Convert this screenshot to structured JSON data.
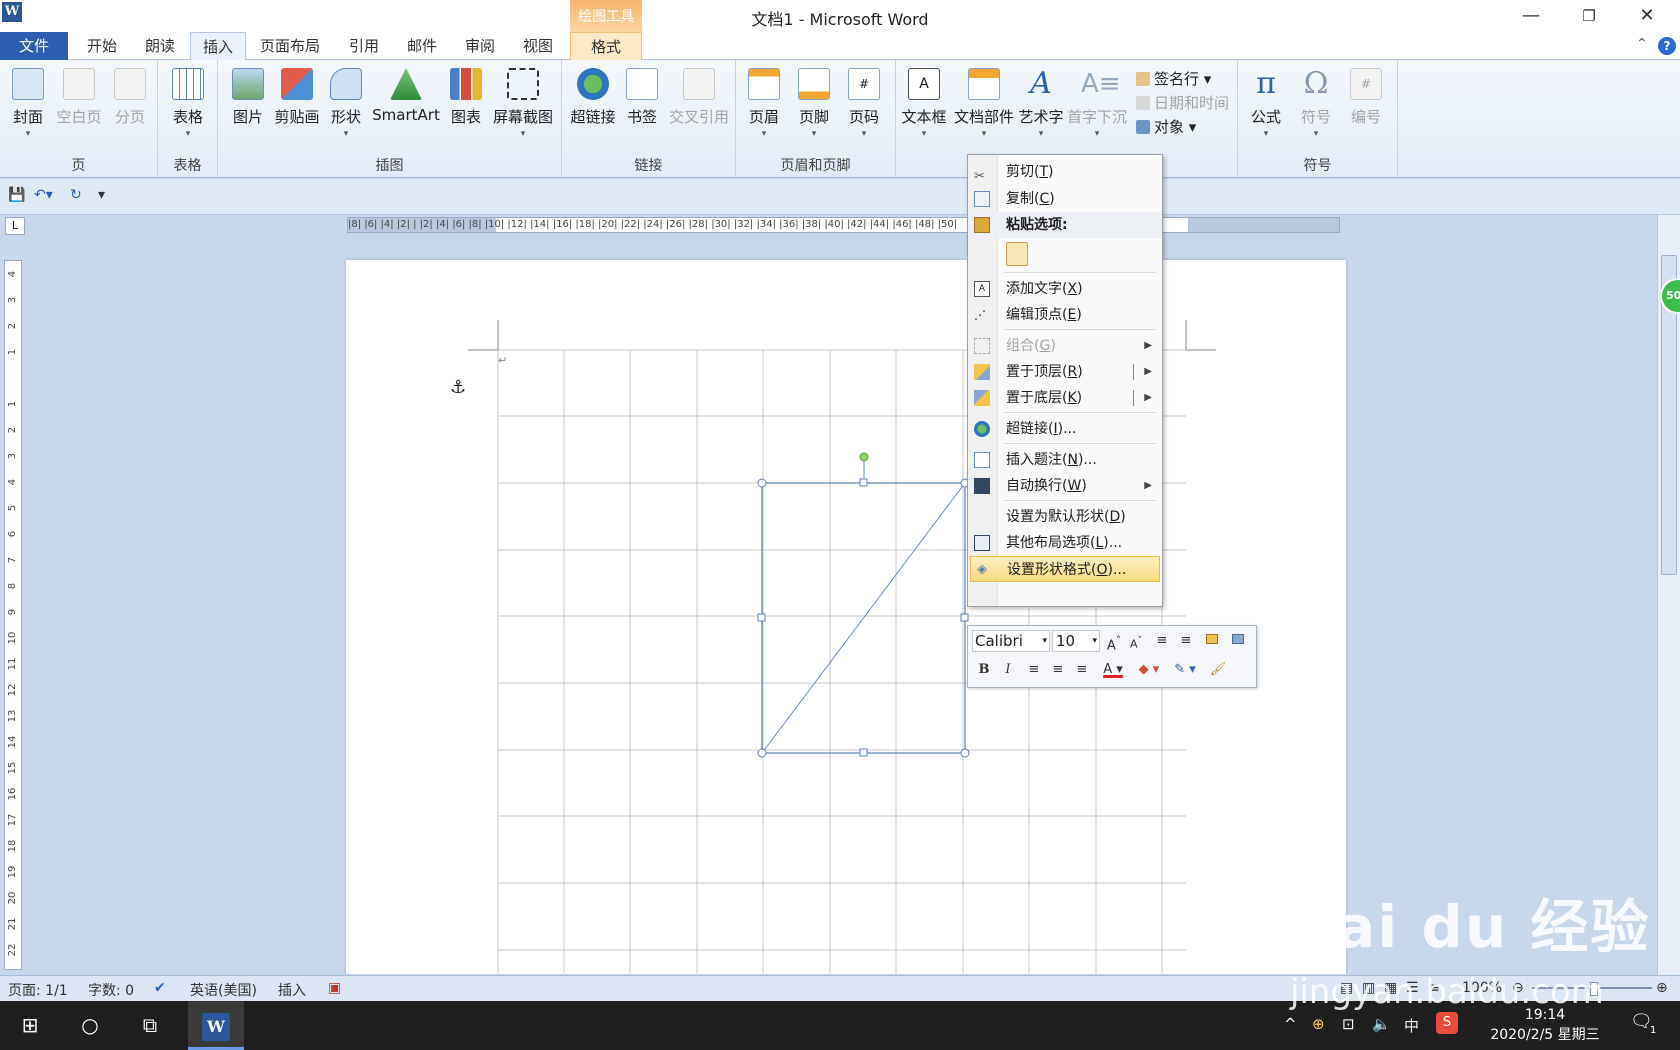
{
  "window": {
    "title": "文档1 - Microsoft Word",
    "minimize": "—",
    "restore": "❐",
    "close": "✕"
  },
  "context_group": {
    "label": "绘图工具"
  },
  "tabs": [
    "文件",
    "开始",
    "朗读",
    "插入",
    "页面布局",
    "引用",
    "邮件",
    "审阅",
    "视图",
    "格式"
  ],
  "active_tab": "插入",
  "ribbon": {
    "groups": {
      "page": {
        "label": "页",
        "buttons": [
          "封面",
          "空白页",
          "分页"
        ]
      },
      "table": {
        "label": "表格",
        "buttons": [
          "表格"
        ]
      },
      "illus": {
        "label": "插图",
        "buttons": [
          "图片",
          "剪贴画",
          "形状",
          "SmartArt",
          "图表",
          "屏幕截图"
        ]
      },
      "links": {
        "label": "链接",
        "buttons": [
          "超链接",
          "书签",
          "交叉引用"
        ]
      },
      "hf": {
        "label": "页眉和页脚",
        "buttons": [
          "页眉",
          "页脚",
          "页码"
        ]
      },
      "text": {
        "label": "文本",
        "buttons": [
          "文本框",
          "文档部件",
          "艺术字",
          "首字下沉"
        ],
        "small": [
          "签名行",
          "日期和时间",
          "对象"
        ]
      },
      "symbols": {
        "label": "符号",
        "buttons": [
          "公式",
          "符号",
          "编号"
        ]
      }
    }
  },
  "ruler": {
    "h_labels": "|8| |6| |4| |2| | |2| |4| |6| |8| |10| |12| |14| |16| |18| |20| |22| |24| |26| |28| |30| |32| |34| |36| |38| |40| |42| |44| |46| |48| |50|",
    "v_labels": [
      "4",
      "3",
      "2",
      "1",
      "",
      "1",
      "2",
      "3",
      "4",
      "5",
      "6",
      "7",
      "8",
      "9",
      "10",
      "11",
      "12",
      "13",
      "14",
      "15",
      "16",
      "17",
      "18",
      "19",
      "20",
      "21",
      "22"
    ]
  },
  "context_menu": {
    "cut": {
      "label": "剪切(",
      "key": "T",
      "end": ")"
    },
    "copy": {
      "label": "复制(",
      "key": "C",
      "end": ")"
    },
    "paste_options": "粘贴选项:",
    "add_text": {
      "label": "添加文字(",
      "key": "X",
      "end": ")"
    },
    "edit_points": {
      "label": "编辑顶点(",
      "key": "E",
      "end": ")"
    },
    "group": {
      "label": "组合(",
      "key": "G",
      "end": ")"
    },
    "bring_front": {
      "label": "置于顶层(",
      "key": "R",
      "end": ")"
    },
    "send_back": {
      "label": "置于底层(",
      "key": "K",
      "end": ")"
    },
    "hyperlink": {
      "label": "超链接(",
      "key": "I",
      "end": ")..."
    },
    "caption": {
      "label": "插入题注(",
      "key": "N",
      "end": ")..."
    },
    "wrap": {
      "label": "自动换行(",
      "key": "W",
      "end": ")"
    },
    "default_shape": {
      "label": "设置为默认形状(",
      "key": "D",
      "end": ")"
    },
    "layout": {
      "label": "其他布局选项(",
      "key": "L",
      "end": ")..."
    },
    "format_shape": {
      "label": "设置形状格式(",
      "key": "O",
      "end": ")..."
    }
  },
  "mini_toolbar": {
    "font": "Calibri",
    "size": "10"
  },
  "status": {
    "page": "页面: 1/1",
    "words": "字数: 0",
    "lang": "英语(美国)",
    "mode": "插入",
    "zoom": "100%"
  },
  "taskbar": {
    "time": "19:14",
    "date": "2020/2/5 星期三",
    "ime": "中",
    "notif_count": "1"
  },
  "watermark": {
    "brand": "Bai du 经验",
    "url": "jingyan.baidu.com"
  },
  "badge": {
    "value": "50"
  },
  "colors": {
    "accent": "#2b5eb0",
    "format_tab": "#f6b26b",
    "menu_highlight": "#f7d97d"
  }
}
